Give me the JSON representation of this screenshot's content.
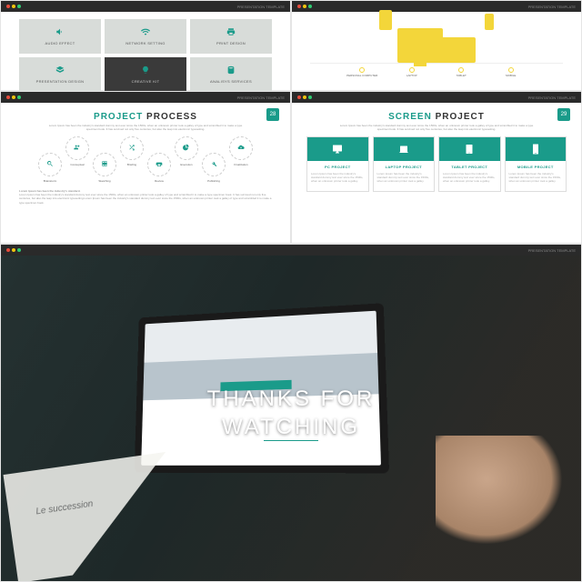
{
  "footer": "PRESENTATION TEMPLATE",
  "pages": {
    "s3": "28",
    "s4": "29"
  },
  "s1": {
    "tiles": [
      {
        "icon": "volume",
        "label": "AUDIO EFFECT"
      },
      {
        "icon": "wifi",
        "label": "NETWORK SETTING"
      },
      {
        "icon": "print",
        "label": "PRINT DESIGN"
      },
      {
        "icon": "layers",
        "label": "PRESENTATION DESIGN"
      },
      {
        "icon": "bulb",
        "label": "CREATIVE KIT",
        "dark": true
      },
      {
        "icon": "db",
        "label": "ANALISYS SERVICES"
      }
    ]
  },
  "s2": {
    "items": [
      {
        "label": "PERSONAL COMPUTER"
      },
      {
        "label": "LAPTOP"
      },
      {
        "label": "TABLET"
      },
      {
        "label": "MOBILE"
      }
    ]
  },
  "s3": {
    "titleA": "PROJECT",
    "titleB": "PROCESS",
    "sub": "Lorem Ipsum has been the industry's standard dummy text ever since the 1500s, when an unknown printer took a galley of type and scrambled it to make a type specimen book. It has survived not only five centuries, but also the leap into electronic typesetting.",
    "circles": [
      {
        "icon": "search",
        "label": "Brainstorm",
        "pos": "dn"
      },
      {
        "icon": "meet",
        "label": "Conceptual",
        "pos": "up"
      },
      {
        "icon": "film",
        "label": "Sketching",
        "pos": "dn"
      },
      {
        "icon": "shuffle",
        "label": "Briefing",
        "pos": "up"
      },
      {
        "icon": "print2",
        "label": "Review",
        "pos": "dn"
      },
      {
        "icon": "pie",
        "label": "Execution",
        "pos": "up"
      },
      {
        "icon": "tools",
        "label": "Publishing",
        "pos": "dn"
      },
      {
        "icon": "cloud",
        "label": "Finalization",
        "pos": "up"
      }
    ],
    "loremH": "Lorem Ipsum has been the industry's standard.",
    "lorem": "Lorem Ipsum has been the industry's standard dummy text ever since the 1500s, when an unknown printer took a galley of type and scrambled it to make a type specimen book. It has survived not only five centuries, but also the leap into electronic typesetting.Lorem Ipsum has been the industry's standard dummy text ever since the 1500s, when an unknown printer took a galley of type and scrambled it to make a type specimen book."
  },
  "s4": {
    "titleA": "SCREEN",
    "titleB": "PROJECT",
    "sub": "Lorem Ipsum has been the industry's standard dummy text ever since the 1500s, when an unknown printer took a galley of type and scrambled it to make a type specimen book. It has survived not only five centuries, but also the leap into electronic typesetting.",
    "boxes": [
      {
        "icon": "monitor",
        "title": "PC PROJECT",
        "desc": "Lorem Ipsum has been the industry's standard dummy text ever since the 1500s, when an unknown printer took a galley."
      },
      {
        "icon": "laptop",
        "title": "LAPTOP PROJECT",
        "desc": "Lorem Ipsum has been the industry's standard dummy text ever since the 1500s, when an unknown printer took a galley."
      },
      {
        "icon": "tablet",
        "title": "TABLET PROJECT",
        "desc": "Lorem Ipsum has been the industry's standard dummy text ever since the 1500s, when an unknown printer took a galley."
      },
      {
        "icon": "mobile",
        "title": "MOBILE PROJECT",
        "desc": "Lorem Ipsum has been the industry's standard dummy text ever since the 1500s, when an unknown printer took a galley."
      }
    ]
  },
  "s5": {
    "title": "THANKS FOR\nWATCHING",
    "paper": "Le succession"
  }
}
